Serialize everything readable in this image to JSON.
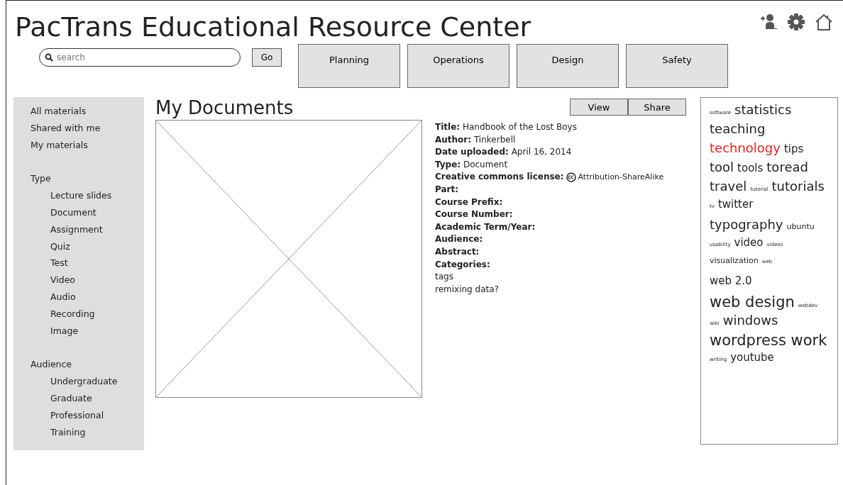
{
  "header": {
    "title": "PacTrans Educational Resource Center"
  },
  "search": {
    "placeholder": "search",
    "button": "Go"
  },
  "nav_tabs": [
    {
      "label": "Planning"
    },
    {
      "label": "Operations"
    },
    {
      "label": "Design"
    },
    {
      "label": "Safety"
    }
  ],
  "sidebar": {
    "items": [
      {
        "label": "All materials"
      },
      {
        "label": "Shared with me"
      },
      {
        "label": "My materials"
      },
      {
        "label": "Type",
        "children": [
          {
            "label": "Lecture slides"
          },
          {
            "label": "Document"
          },
          {
            "label": "Assignment"
          },
          {
            "label": "Quiz"
          },
          {
            "label": "Test"
          },
          {
            "label": "Video"
          },
          {
            "label": "Audio"
          },
          {
            "label": "Recording"
          },
          {
            "label": "Image"
          }
        ]
      },
      {
        "label": "Audience",
        "children": [
          {
            "label": "Undergraduate"
          },
          {
            "label": "Graduate"
          },
          {
            "label": "Professional"
          },
          {
            "label": "Training"
          }
        ]
      }
    ]
  },
  "document": {
    "heading": "My Documents",
    "actions": [
      "View",
      "Share"
    ],
    "metadata": [
      {
        "kind": "field",
        "label": "Title:",
        "value": "Handbook of the Lost Boys"
      },
      {
        "kind": "field",
        "label": "Author:",
        "value": "Tinkerbell"
      },
      {
        "kind": "field",
        "label": "Date uploaded:",
        "value": "April 16, 2014"
      },
      {
        "kind": "field",
        "label": "Type:",
        "value": "Document"
      },
      {
        "kind": "license",
        "label": "Creative commons license:",
        "value": "Attribution-ShareAlike"
      },
      {
        "kind": "field",
        "label": "Part:"
      },
      {
        "kind": "field",
        "label": "Course Prefix:"
      },
      {
        "kind": "field",
        "label": "Course Number:"
      },
      {
        "kind": "field",
        "label": "Academic Term/Year:"
      },
      {
        "kind": "field",
        "label": "Audience:"
      },
      {
        "kind": "field",
        "label": "Abstract:"
      },
      {
        "kind": "field",
        "label": "Categories:"
      },
      {
        "kind": "note",
        "value": "tags"
      },
      {
        "kind": "note",
        "value": "remixing data?"
      }
    ]
  },
  "tag_cloud": {
    "lines": [
      [
        {
          "text": "software",
          "kind": "tiny",
          "highlighted": false
        },
        {
          "text": "statistics",
          "kind": "large",
          "highlighted": false
        }
      ],
      [
        {
          "text": "teaching",
          "kind": "large",
          "highlighted": false
        }
      ],
      [
        {
          "text": "technology",
          "kind": "large",
          "highlighted": true
        },
        {
          "text": "tips",
          "kind": "medium",
          "highlighted": false
        }
      ],
      [
        {
          "text": "tool",
          "kind": "large",
          "highlighted": false
        },
        {
          "text": "tools",
          "kind": "medium",
          "highlighted": false
        },
        {
          "text": "toread",
          "kind": "large",
          "highlighted": false
        }
      ],
      [
        {
          "text": "travel",
          "kind": "large",
          "highlighted": false
        },
        {
          "text": "tutorial",
          "kind": "tiny",
          "highlighted": false
        },
        {
          "text": "tutorials",
          "kind": "large",
          "highlighted": false
        }
      ],
      [
        {
          "text": "tv",
          "kind": "tiny",
          "highlighted": false
        },
        {
          "text": "twitter",
          "kind": "medium",
          "highlighted": false
        }
      ],
      [
        {
          "text": "typography",
          "kind": "large",
          "highlighted": false
        },
        {
          "text": "ubuntu",
          "kind": "small",
          "highlighted": false
        }
      ],
      [
        {
          "text": "usability",
          "kind": "tiny",
          "highlighted": false
        },
        {
          "text": "video",
          "kind": "medium",
          "highlighted": false
        },
        {
          "text": "videos",
          "kind": "tiny",
          "highlighted": false
        }
      ],
      [
        {
          "text": "visualization",
          "kind": "small",
          "highlighted": false
        },
        {
          "text": "web",
          "kind": "tiny",
          "highlighted": false
        }
      ],
      [
        {
          "text": "web 2.0",
          "kind": "medium",
          "highlighted": false
        }
      ],
      [
        {
          "text": "web design",
          "kind": "huge",
          "highlighted": false
        },
        {
          "text": "webdev",
          "kind": "tiny",
          "highlighted": false
        }
      ],
      [
        {
          "text": "wiki",
          "kind": "tiny",
          "highlighted": false
        },
        {
          "text": "windows",
          "kind": "large",
          "highlighted": false
        }
      ],
      [
        {
          "text": "wordpress work",
          "kind": "huge",
          "highlighted": false
        }
      ],
      [
        {
          "text": "writing",
          "kind": "tiny",
          "highlighted": false
        },
        {
          "text": "youtube",
          "kind": "medium",
          "highlighted": false
        }
      ]
    ]
  }
}
